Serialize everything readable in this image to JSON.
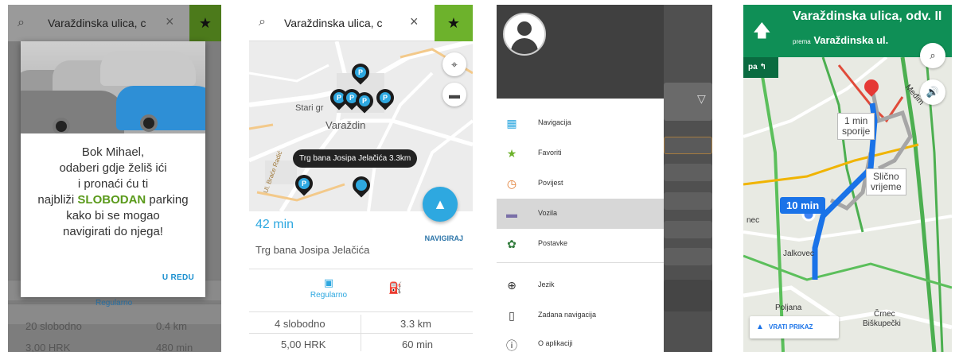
{
  "search": {
    "query": "Varaždinska ulica, c",
    "clear_label": "×",
    "favorite_label": "★"
  },
  "screen1": {
    "greeting_line1": "Bok Mihael,",
    "greeting_line2": "odaberi gdje želiš ići",
    "greeting_line3": "i pronaći ću ti",
    "greeting_line4_pre": "najbliži ",
    "greeting_line4_highlight": "SLOBODAN",
    "greeting_line4_post": " parking",
    "greeting_line5": "kako bi se mogao",
    "greeting_line6": "navigirati do njega!",
    "ok_button": "U REDU",
    "bg_mode": "Regularno",
    "bg_row1": [
      "20 slobodno",
      "0.4 km"
    ],
    "bg_row2": [
      "3,00 HRK",
      "480 min"
    ],
    "highlight_color": "#5a9a1b"
  },
  "screen2": {
    "map_labels": {
      "stari_grad": "Stari gr",
      "varazdin": "Varaždin",
      "road": "Ul. Braće Radić"
    },
    "tooltip": "Trg bana Josipa Jelačića 3.3km",
    "eta": "42 min",
    "navigate_label": "NAVIGIRAJ",
    "destination": "Trg bana Josipa Jelačića",
    "mode_regular": "Regularno",
    "row1": [
      "4 slobodno",
      "3.3 km"
    ],
    "row2": [
      "5,00 HRK",
      "60 min"
    ],
    "accent_color": "#2ea8e0"
  },
  "screen3": {
    "menu": [
      {
        "label": "Navigacija",
        "icon": "map-icon",
        "glyph": "▦",
        "color": "#2ea8e0"
      },
      {
        "label": "Favoriti",
        "icon": "star-icon",
        "glyph": "★",
        "color": "#6db22c"
      },
      {
        "label": "Povijest",
        "icon": "history-icon",
        "glyph": "◷",
        "color": "#e07a2e"
      },
      {
        "label": "Vozila",
        "icon": "car-icon",
        "glyph": "▬",
        "color": "#7a6fa8"
      },
      {
        "label": "Postavke",
        "icon": "gear-icon",
        "glyph": "✿",
        "color": "#2f7a3a"
      },
      {
        "label": "Jezik",
        "icon": "globe-icon",
        "glyph": "⊕",
        "color": "#333333"
      },
      {
        "label": "Zadana navigacija",
        "icon": "book-map-icon",
        "glyph": "▯",
        "color": "#333333"
      },
      {
        "label": "O aplikaciji",
        "icon": "info-icon",
        "glyph": "ⓘ",
        "color": "#333333"
      }
    ],
    "dropdown_glyph": "▽"
  },
  "screen4": {
    "street": "Varaždinska ulica, odv. II",
    "prema_prefix": "prema",
    "prema_street": "Varaždinska ul.",
    "then_label": "pa",
    "route_time": "10 min",
    "alt1_line1": "1 min",
    "alt1_line2": "sporije",
    "alt2_line1": "Slično",
    "alt2_line2": "vrijeme",
    "places": {
      "jalkovec": "Jalkovec",
      "nec": "nec",
      "poljana": "Poljana",
      "crnec1": "Črnec",
      "crnec2": "Biškupečki",
      "medim": "Međim"
    },
    "back_view": "VRATI PRIKAZ",
    "header_color": "#0f8f56"
  }
}
